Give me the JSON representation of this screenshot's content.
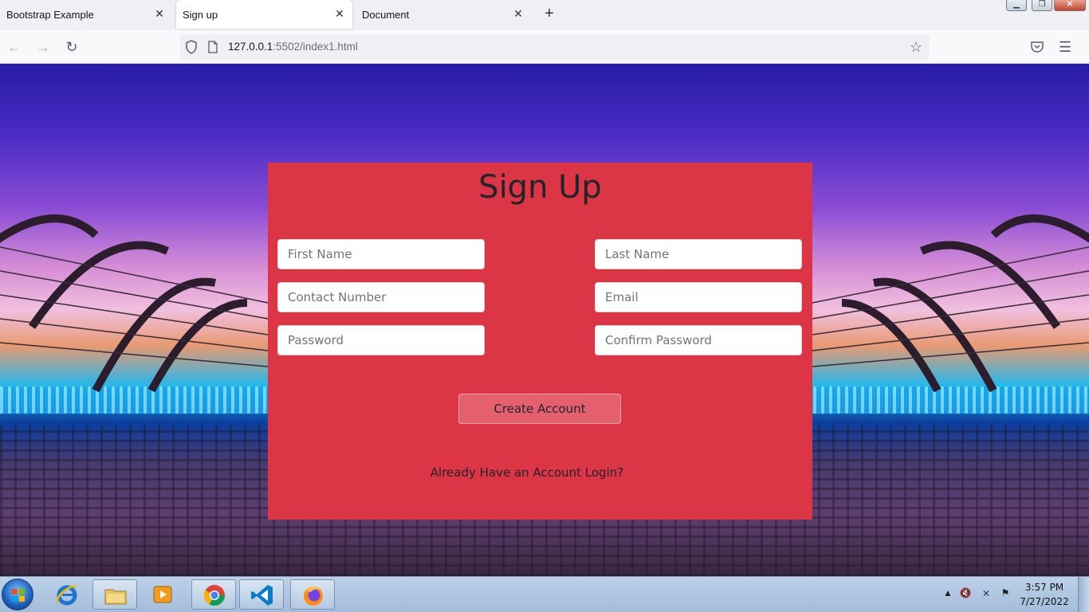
{
  "browser": {
    "tabs": [
      {
        "title": "Bootstrap Example",
        "active": false
      },
      {
        "title": "Sign up",
        "active": true
      },
      {
        "title": "Document",
        "active": false
      }
    ],
    "url_host": "127.0.0.1",
    "url_rest": ":5502/index1.html"
  },
  "signup": {
    "title": "Sign Up",
    "first_name_placeholder": "First Name",
    "last_name_placeholder": "Last Name",
    "contact_placeholder": "Contact Number",
    "email_placeholder": "Email",
    "password_placeholder": "Password",
    "confirm_password_placeholder": "Confirm Password",
    "create_button": "Create Account",
    "login_link": "Already Have an Account Login?"
  },
  "colors": {
    "card": "#dc3545",
    "button": "#e4606d"
  },
  "taskbar": {
    "pinned_apps": [
      "internet-explorer-icon",
      "file-explorer-icon",
      "media-player-icon",
      "chrome-icon",
      "vscode-icon",
      "firefox-icon"
    ],
    "time": "3:57 PM",
    "date": "7/27/2022"
  }
}
